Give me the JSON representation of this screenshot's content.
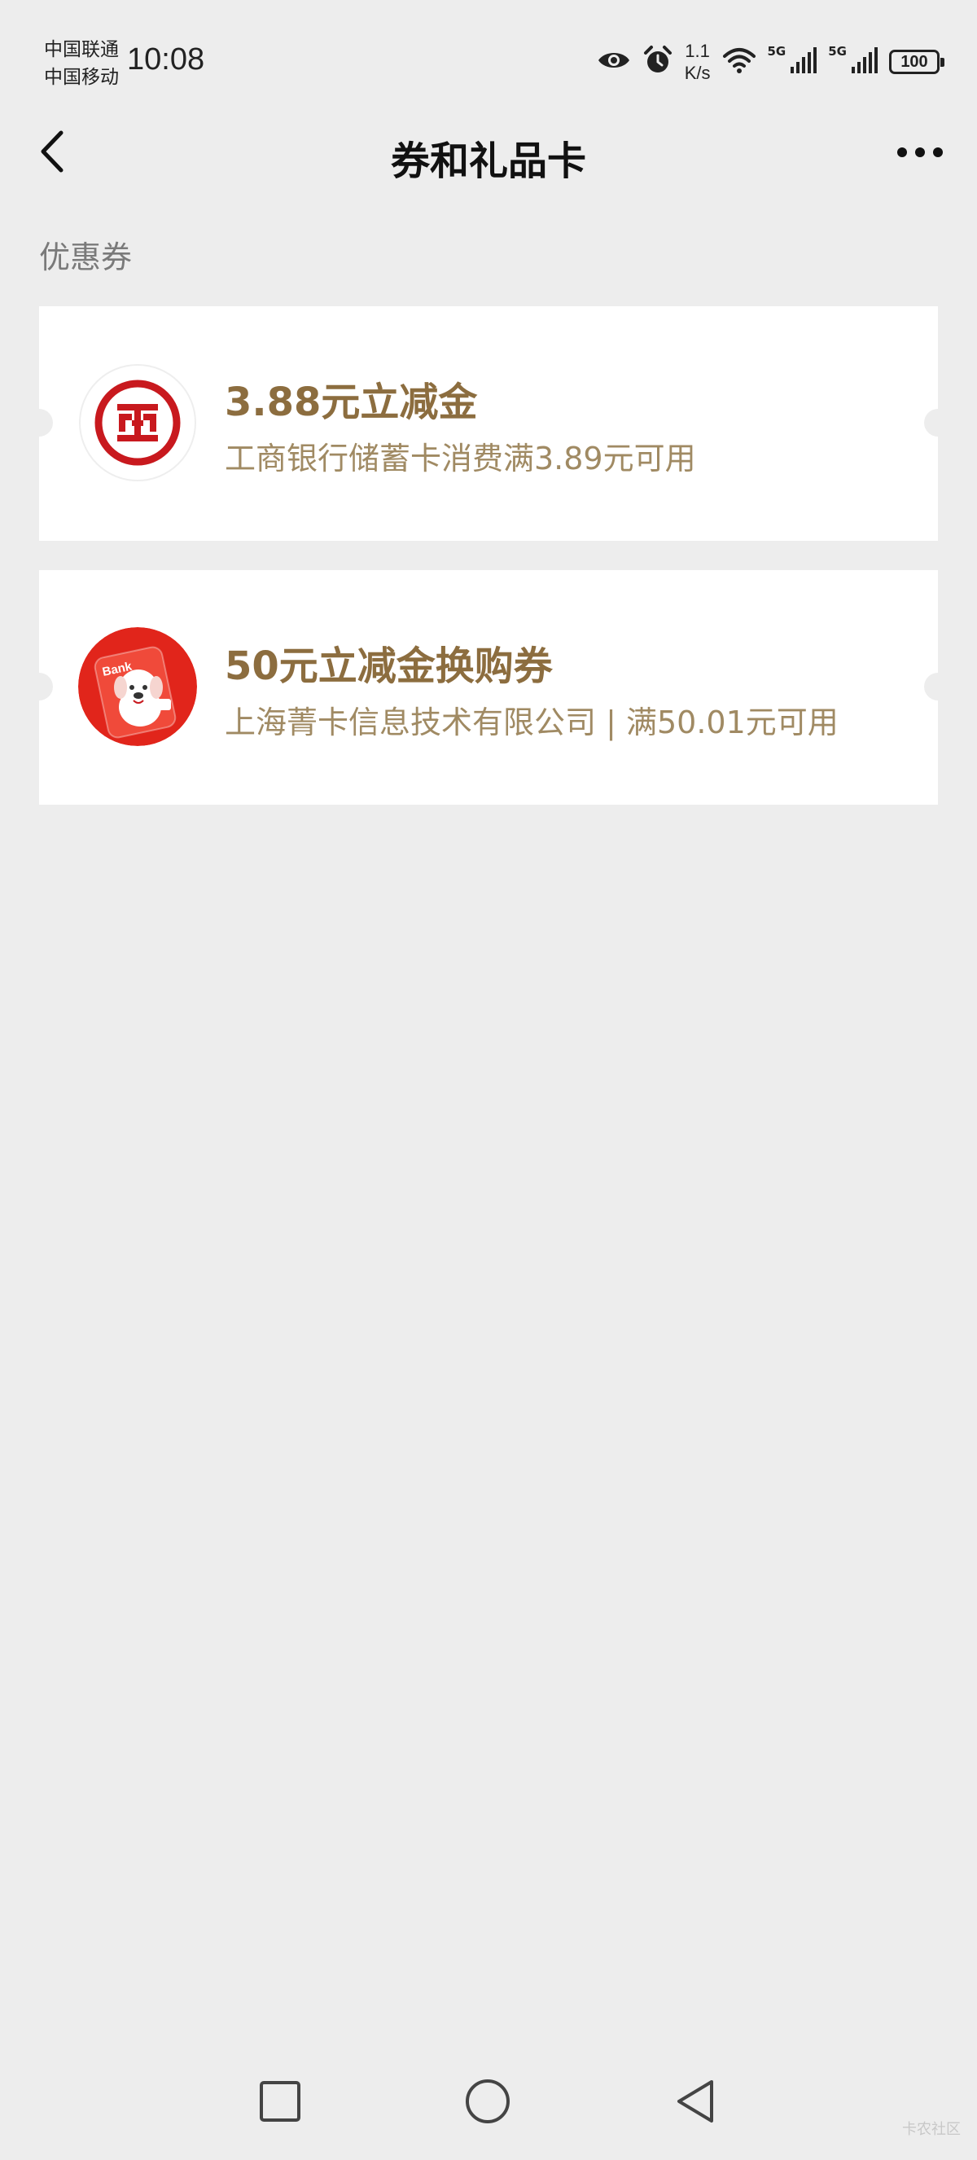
{
  "status_bar": {
    "carrier_1": "中国联通",
    "carrier_2": "中国移动",
    "time": "10:08",
    "net_speed_value": "1.1",
    "net_speed_unit": "K/s",
    "net_gen_1": "5G",
    "net_gen_2": "5G",
    "battery": "100",
    "icons": [
      "eye-icon",
      "alarm-icon",
      "wifi-icon",
      "signal-icon",
      "signal-icon",
      "battery-icon"
    ]
  },
  "nav": {
    "title": "券和礼品卡",
    "back_icon": "chevron-left-icon",
    "more_icon": "more-dots-icon"
  },
  "section": {
    "label": "优惠券"
  },
  "coupons": [
    {
      "title": "3.88元立减金",
      "description": "工商银行储蓄卡消费满3.89元可用",
      "logo": "icbc-logo",
      "title_color": "#8c6d3f"
    },
    {
      "title": "50元立减金换购券",
      "description": "上海菁卡信息技术有限公司 | 满50.01元可用",
      "logo": "jd-bank-mascot-logo",
      "title_color": "#8c6d3f"
    }
  ],
  "system_nav": {
    "icons": [
      "square-icon",
      "circle-icon",
      "triangle-back-icon"
    ]
  },
  "watermark": "卡农社区",
  "colors": {
    "background": "#ededed",
    "card": "#ffffff",
    "coupon_title": "#8c6d3f",
    "coupon_desc": "#a08a63",
    "icbc_red": "#c8191e",
    "jd_red": "#e1251b"
  }
}
